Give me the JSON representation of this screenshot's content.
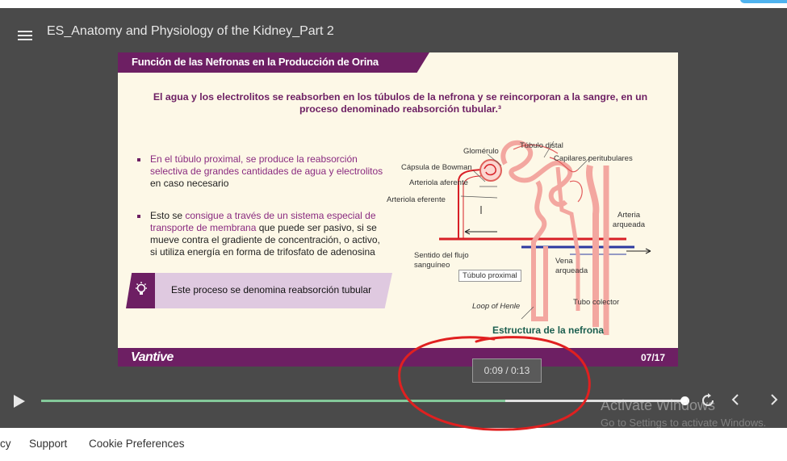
{
  "player": {
    "title": "ES_Anatomy and Physiology of the Kidney_Part 2",
    "time_display": "0:09 / 0:13",
    "progress_fraction": 0.72,
    "buffer_fraction": 1.0
  },
  "slide": {
    "header": "Función de las Nefronas en la Producción de Orina",
    "lead": "El agua y los electrolitos se reabsorben en los túbulos de la nefrona y se reincorporan a la sangre, en un proceso denominado reabsorción tubular.³",
    "bullet1": {
      "highlight": "En el túbulo proximal, se produce la reabsorción selectiva de grandes cantidades de agua y electrolitos",
      "rest": " en caso necesario"
    },
    "bullet2": {
      "start": "Esto se ",
      "highlight": "consigue a través de un sistema especial de transporte de membrana",
      "rest": " que puede ser pasivo, si se mueve contra el gradiente de concentración, o activo, si utiliza energía en forma de trifosfato de adenosina"
    },
    "callout": "Este proceso se denomina reabsorción tubular",
    "diagram_labels": {
      "glomerulo": "Glomérulo",
      "tubulo_distal": "Túbulo distal",
      "capsula": "Cápsula de Bowman",
      "capilares": "Capilares peritubulares",
      "arteriola_aferente": "Arteriola aferente",
      "arteriola_eferente": "Arteriola eferente",
      "arteria_arqueada": "Arteria arqueada",
      "sentido_flujo": "Sentido del flujo sanguíneo",
      "tubulo_proximal": "Túbulo proximal",
      "vena_arqueada": "Vena arqueada",
      "loop_henle": "Loop of Henle",
      "tubo_colector": "Tubo colector"
    },
    "caption": "Estructura de la nefrona",
    "brand": "Vantive",
    "page": "07/17"
  },
  "os_watermark": {
    "line1": "Activate Windows",
    "line2": "Go to Settings to activate Windows."
  },
  "footer": {
    "links": [
      "cy",
      "Support",
      "Cookie Preferences"
    ]
  },
  "colors": {
    "brand_purple": "#6d1f63",
    "progress_green": "#84c99a",
    "annotation_red": "#e02020"
  }
}
